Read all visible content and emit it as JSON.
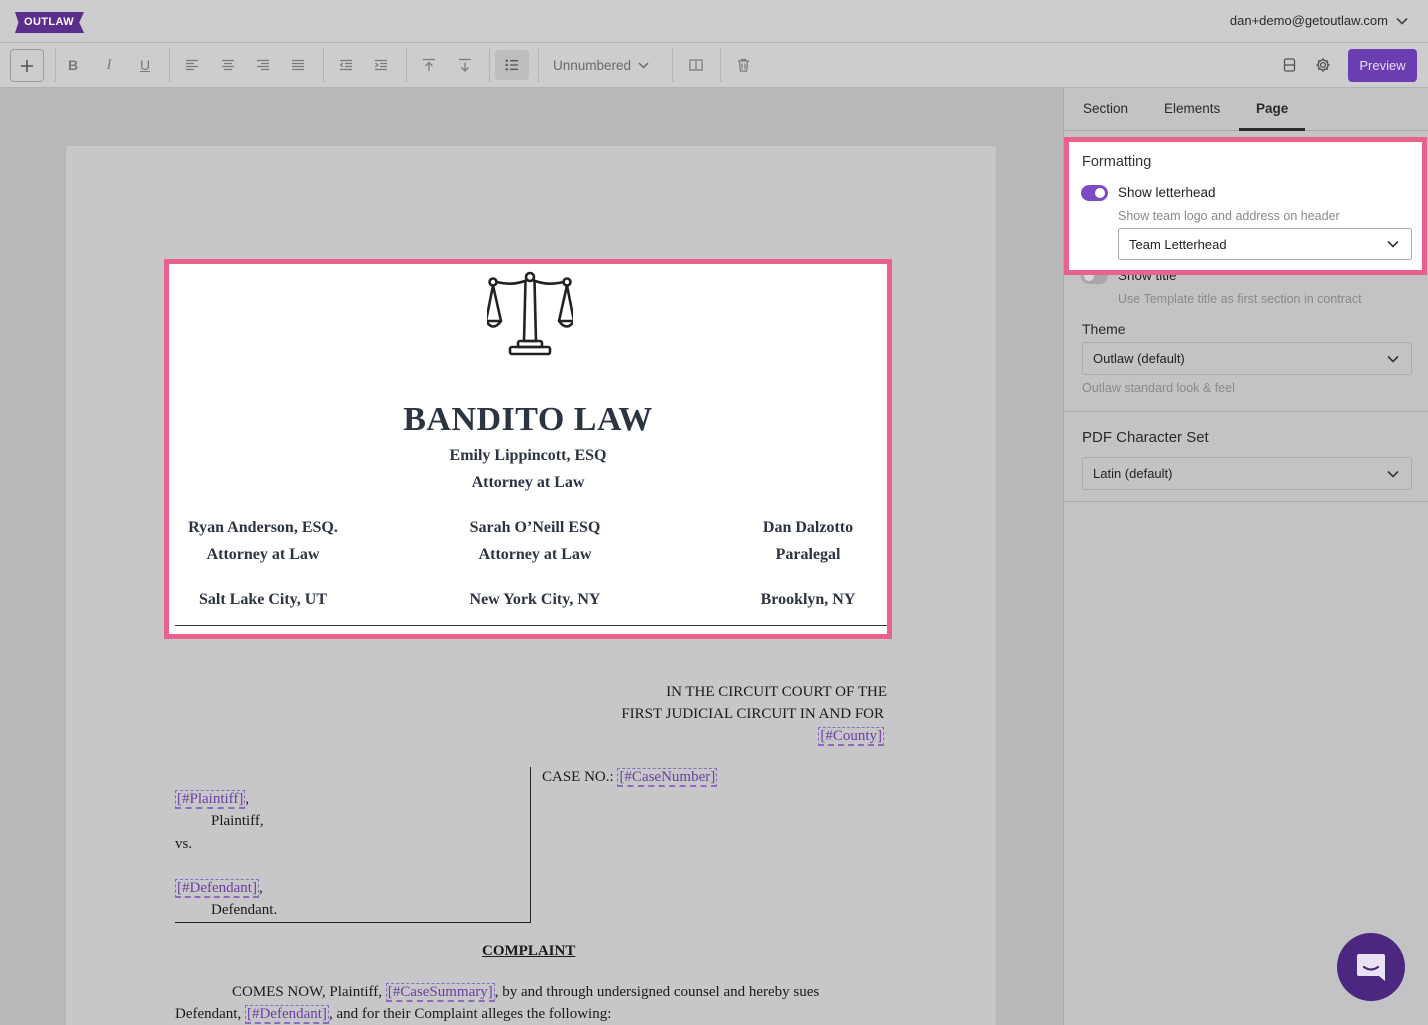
{
  "app": {
    "logo_text": "OUTLAW",
    "user_email": "dan+demo@getoutlaw.com"
  },
  "toolbar": {
    "bold_label": "B",
    "italic_label": "I",
    "underline_label": "U",
    "numbering_value": "Unnumbered",
    "preview_label": "Preview"
  },
  "letterhead": {
    "firm_name": "BANDITO LAW",
    "lead_name": "Emily Lippincott, ESQ",
    "lead_title": "Attorney at Law",
    "members": [
      {
        "name": "Ryan Anderson, ESQ.",
        "title": "Attorney at Law",
        "location": "Salt Lake City, UT"
      },
      {
        "name": "Sarah O’Neill ESQ",
        "title": "Attorney at Law",
        "location": "New York City, NY"
      },
      {
        "name": "Dan Dalzotto",
        "title": "Paralegal",
        "location": "Brooklyn, NY"
      }
    ]
  },
  "document": {
    "court_line1": "IN THE CIRCUIT COURT OF THE",
    "court_line2": "FIRST JUDICIAL CIRCUIT IN AND FOR",
    "county_field": "[#County]",
    "case_no_label": "CASE NO.:",
    "case_number_field": "[#CaseNumber]",
    "plaintiff_field": "[#Plaintiff]",
    "plaintiff_comma": ",",
    "plaintiff_label": "Plaintiff,",
    "vs_label": "vs.",
    "defendant_field": "[#Defendant]",
    "defendant_comma": ",",
    "defendant_label": "Defendant.",
    "heading": "COMPLAINT",
    "body_part1": "COMES NOW, Plaintiff,",
    "case_summary_field": "[#CaseSummary]",
    "body_part2": ", by and through undersigned counsel and hereby sues",
    "body_part3": "Defendant,",
    "body_defendant_field": "[#Defendant]",
    "body_part4": ", and for their Complaint alleges the following:"
  },
  "panel": {
    "tabs": [
      {
        "label": "Section"
      },
      {
        "label": "Elements"
      },
      {
        "label": "Page"
      }
    ],
    "active_tab": "Page",
    "formatting_title": "Formatting",
    "show_letterhead_label": "Show letterhead",
    "show_letterhead_on": true,
    "show_letterhead_help": "Show team logo and address on header",
    "letterhead_select_value": "Team Letterhead",
    "show_title_label": "Show title",
    "show_title_on": false,
    "show_title_help": "Use Template title as first section in contract",
    "theme_title": "Theme",
    "theme_value": "Outlaw (default)",
    "theme_help": "Outlaw standard look & feel",
    "pdf_title": "PDF Character Set",
    "pdf_value": "Latin (default)"
  },
  "colors": {
    "accent": "#6a3eb0",
    "highlight": "#e8628c",
    "field": "#6b3fa3"
  }
}
